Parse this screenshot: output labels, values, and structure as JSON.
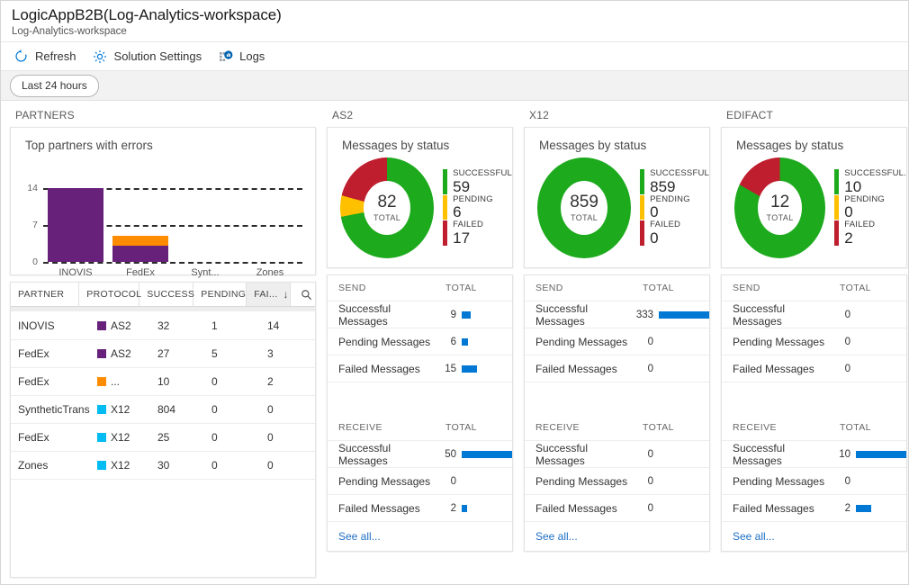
{
  "header": {
    "title": "LogicAppB2B(Log-Analytics-workspace)",
    "subtitle": "Log-Analytics-workspace"
  },
  "toolbar": {
    "refresh_label": "Refresh",
    "refresh_icon": "refresh-icon",
    "settings_label": "Solution Settings",
    "settings_icon": "gear-icon",
    "logs_label": "Logs",
    "logs_icon": "logs-chart-icon"
  },
  "filter": {
    "time_range": "Last 24 hours"
  },
  "colors": {
    "green": "#1DAA1D",
    "red": "#BE1E2D",
    "amber": "#FFC000",
    "purple": "#68217A",
    "orange": "#FF8C00",
    "cyan": "#00BCF2",
    "blue": "#0078D4",
    "link": "#1E6FC4"
  },
  "partners": {
    "column_header": "PARTNERS",
    "chart_data": {
      "type": "bar",
      "title": "Top partners with errors",
      "categories": [
        "INOVIS",
        "FedEx",
        "Synt...",
        "Zones"
      ],
      "series": [
        {
          "name": "AS2",
          "color": "#68217A",
          "values": [
            14,
            3,
            0,
            0
          ]
        },
        {
          "name": "EDIFACT",
          "color": "#FF8C00",
          "values": [
            0,
            2,
            0,
            0
          ]
        }
      ],
      "ylim": [
        0,
        14
      ],
      "yticks": [
        0,
        7,
        14
      ],
      "ytick_labels": [
        "0",
        "7",
        "14"
      ],
      "xlabel": "",
      "ylabel": "",
      "grid": true,
      "legend": "none",
      "stacked": true
    },
    "table": {
      "headers": [
        "PARTNER",
        "PROTOCOL",
        "SUCCESS",
        "PENDING",
        "FAI..."
      ],
      "sorted_column": "FAI...",
      "sort_direction": "descending",
      "sort_icon": "arrow-down-icon",
      "search_icon": "search-icon",
      "rows": [
        {
          "partner": "INOVIS",
          "protocol": "AS2",
          "protocol_color": "#68217A",
          "success": "32",
          "pending": "1",
          "failed": "14"
        },
        {
          "partner": "FedEx",
          "protocol": "AS2",
          "protocol_color": "#68217A",
          "success": "27",
          "pending": "5",
          "failed": "3"
        },
        {
          "partner": "FedEx",
          "protocol": "...",
          "protocol_color": "#FF8C00",
          "success": "10",
          "pending": "0",
          "failed": "2"
        },
        {
          "partner": "SyntheticTrans",
          "protocol": "X12",
          "protocol_color": "#00BCF2",
          "success": "804",
          "pending": "0",
          "failed": "0"
        },
        {
          "partner": "FedEx",
          "protocol": "X12",
          "protocol_color": "#00BCF2",
          "success": "25",
          "pending": "0",
          "failed": "0"
        },
        {
          "partner": "Zones",
          "protocol": "X12",
          "protocol_color": "#00BCF2",
          "success": "30",
          "pending": "0",
          "failed": "0"
        }
      ]
    }
  },
  "protocols": [
    {
      "column_header": "AS2",
      "donut": {
        "chart_data": {
          "type": "pie",
          "title": "Messages by status",
          "categories": [
            "SUCCESSFUL",
            "PENDING",
            "FAILED"
          ],
          "values": [
            59,
            6,
            17
          ],
          "colors": [
            "#1DAA1D",
            "#FFC000",
            "#BE1E2D"
          ],
          "total": 82,
          "total_label": "TOTAL"
        }
      },
      "send": {
        "section_label": "SEND",
        "total_label": "TOTAL",
        "rows": [
          {
            "label": "Successful Messages",
            "value": "9",
            "bar_pct": 18
          },
          {
            "label": "Pending Messages",
            "value": "6",
            "bar_pct": 12
          },
          {
            "label": "Failed Messages",
            "value": "15",
            "bar_pct": 30
          }
        ]
      },
      "receive": {
        "section_label": "RECEIVE",
        "total_label": "TOTAL",
        "rows": [
          {
            "label": "Successful Messages",
            "value": "50",
            "bar_pct": 100
          },
          {
            "label": "Pending Messages",
            "value": "0",
            "bar_pct": 0
          },
          {
            "label": "Failed Messages",
            "value": "2",
            "bar_pct": 7
          }
        ]
      },
      "see_all": "See all..."
    },
    {
      "column_header": "X12",
      "donut": {
        "chart_data": {
          "type": "pie",
          "title": "Messages by status",
          "categories": [
            "SUCCESSFUL",
            "PENDING",
            "FAILED"
          ],
          "values": [
            859,
            0,
            0
          ],
          "colors": [
            "#1DAA1D",
            "#FFC000",
            "#BE1E2D"
          ],
          "total": 859,
          "total_label": "TOTAL"
        }
      },
      "send": {
        "section_label": "SEND",
        "total_label": "TOTAL",
        "rows": [
          {
            "label": "Successful Messages",
            "value": "333",
            "bar_pct": 100
          },
          {
            "label": "Pending Messages",
            "value": "0",
            "bar_pct": 0
          },
          {
            "label": "Failed Messages",
            "value": "0",
            "bar_pct": 0
          }
        ]
      },
      "receive": {
        "section_label": "RECEIVE",
        "total_label": "TOTAL",
        "rows": [
          {
            "label": "Successful Messages",
            "value": "0",
            "bar_pct": 0
          },
          {
            "label": "Pending Messages",
            "value": "0",
            "bar_pct": 0
          },
          {
            "label": "Failed Messages",
            "value": "0",
            "bar_pct": 0
          }
        ]
      },
      "see_all": "See all..."
    },
    {
      "column_header": "EDIFACT",
      "donut": {
        "chart_data": {
          "type": "pie",
          "title": "Messages by status",
          "categories": [
            "SUCCESSFUL.",
            "PENDING",
            "FAILED"
          ],
          "values": [
            10,
            0,
            2
          ],
          "colors": [
            "#1DAA1D",
            "#FFC000",
            "#BE1E2D"
          ],
          "total": 12,
          "total_label": "TOTAL"
        }
      },
      "send": {
        "section_label": "SEND",
        "total_label": "TOTAL",
        "rows": [
          {
            "label": "Successful Messages",
            "value": "0",
            "bar_pct": 0
          },
          {
            "label": "Pending Messages",
            "value": "0",
            "bar_pct": 0
          },
          {
            "label": "Failed Messages",
            "value": "0",
            "bar_pct": 0
          }
        ]
      },
      "receive": {
        "section_label": "RECEIVE",
        "total_label": "TOTAL",
        "rows": [
          {
            "label": "Successful Messages",
            "value": "10",
            "bar_pct": 100
          },
          {
            "label": "Pending Messages",
            "value": "0",
            "bar_pct": 0
          },
          {
            "label": "Failed Messages",
            "value": "2",
            "bar_pct": 30
          }
        ]
      },
      "see_all": "See all..."
    }
  ]
}
